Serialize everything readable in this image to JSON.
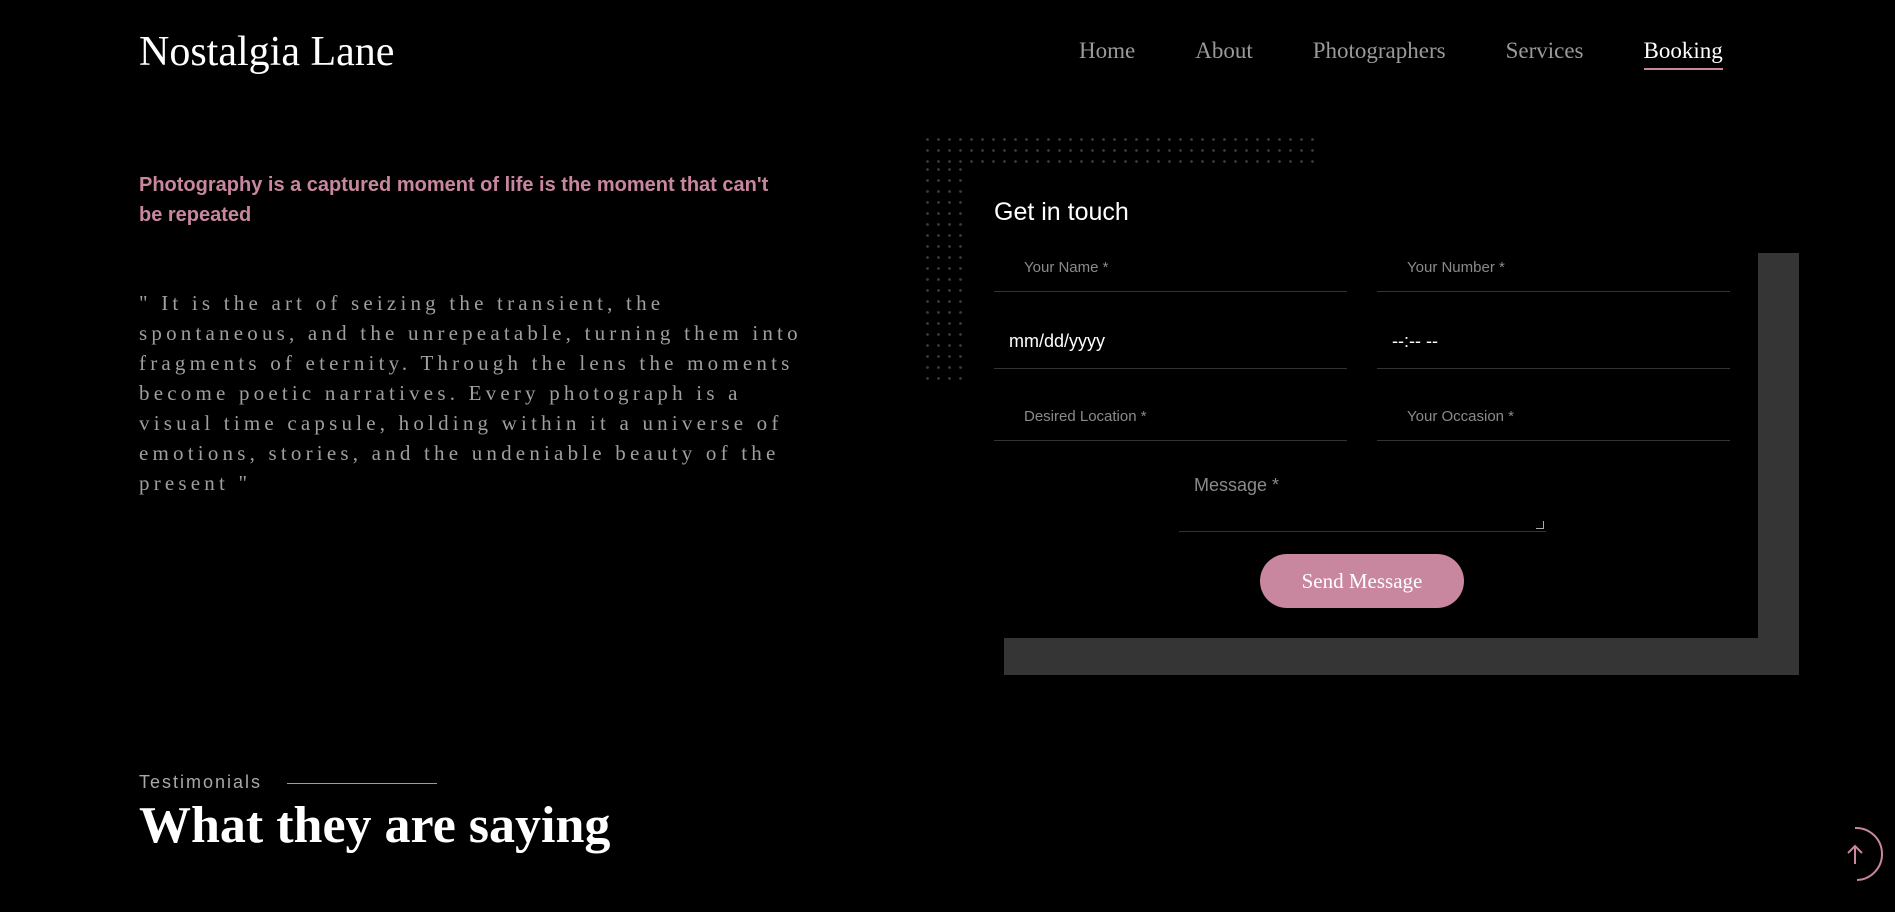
{
  "header": {
    "logo": "Nostalgia Lane",
    "nav": [
      {
        "label": "Home",
        "active": false
      },
      {
        "label": "About",
        "active": false
      },
      {
        "label": "Photographers",
        "active": false
      },
      {
        "label": "Services",
        "active": false
      },
      {
        "label": "Booking",
        "active": true
      }
    ]
  },
  "intro": {
    "tagline": "Photography is a captured moment of life is the moment that can't be repeated",
    "quote": "\" It is the art of seizing the transient, the spontaneous, and the unrepeatable, turning them into fragments of eternity. Through the lens the moments become poetic narratives. Every photograph is a visual time capsule, holding within it a universe of emotions, stories, and the undeniable beauty of the present \""
  },
  "form": {
    "title": "Get in touch",
    "name_placeholder": "Your Name *",
    "number_placeholder": "Your Number *",
    "date_value": "mm/dd/yyyy",
    "time_value": "--:-- --",
    "location_placeholder": "Desired Location *",
    "occasion_placeholder": "Your Occasion *",
    "message_placeholder": "Message *",
    "submit_label": "Send Message"
  },
  "testimonials": {
    "label": "Testimonials",
    "title": "What they are saying"
  },
  "colors": {
    "accent": "#c8869f",
    "background": "#000000",
    "card_shadow": "#353535"
  },
  "icons": {
    "scroll_top": "arrow-up-icon"
  }
}
